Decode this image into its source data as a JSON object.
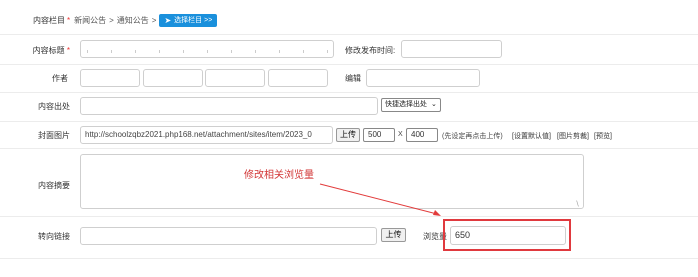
{
  "breadcrumb": {
    "label": "内容栏目",
    "required_mark": "*",
    "path": [
      "新闻公告",
      ">",
      "通知公告",
      ">"
    ],
    "select_button": "选择栏目 >>",
    "select_button_color": "#1a90dc"
  },
  "fields": {
    "title": {
      "label": "内容标题",
      "required_mark": "*",
      "value": ""
    },
    "publish_time": {
      "label": "修改发布时间:",
      "value": ""
    },
    "author": {
      "label": "作者",
      "values": [
        "",
        "",
        "",
        ""
      ]
    },
    "editor": {
      "label": "编辑",
      "value": ""
    },
    "source": {
      "label": "内容出处",
      "value": "",
      "quick_select": "快捷选择出处"
    },
    "cover": {
      "label": "封面图片",
      "url": "http://schoolzqbz2021.php168.net/attachment/sites/item/2023_0",
      "upload_button": "上传",
      "width": "500",
      "times": "X",
      "height": "400",
      "hint": "(先设定再点击上传)",
      "link_default": "[设置默认值]",
      "link_crop": "[图片剪裁]",
      "link_preview": "[预览]"
    },
    "summary": {
      "label": "内容摘要",
      "value": ""
    },
    "redirect": {
      "label": "转向链接",
      "value": "",
      "upload_button": "上传"
    },
    "views": {
      "label": "浏览量",
      "value": "650"
    }
  },
  "annotation": {
    "text": "修改相关浏览量",
    "color": "#e23b3b"
  }
}
